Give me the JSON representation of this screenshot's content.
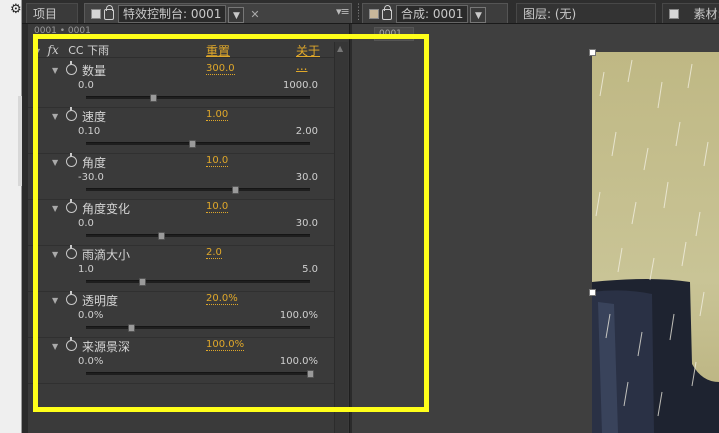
{
  "tabs": {
    "project": "项目",
    "effects_title": "特效控制台: 0001",
    "comp_title": "合成: 0001",
    "layer": "图层: (无)",
    "footage": "素材:"
  },
  "effects": {
    "crumb": "0001 • 0001",
    "effect_name": "CC 下雨",
    "reset": "重置",
    "about": "关于 ...",
    "params": [
      {
        "name": "数量",
        "value": "300.0",
        "min": "0.0",
        "max": "1000.0",
        "fraction": 0.3
      },
      {
        "name": "速度",
        "value": "1.00",
        "min": "0.10",
        "max": "2.00",
        "fraction": 0.474
      },
      {
        "name": "角度",
        "value": "10.0",
        "min": "-30.0",
        "max": "30.0",
        "fraction": 0.667
      },
      {
        "name": "角度变化",
        "value": "10.0",
        "min": "0.0",
        "max": "30.0",
        "fraction": 0.333
      },
      {
        "name": "雨滴大小",
        "value": "2.0",
        "min": "1.0",
        "max": "5.0",
        "fraction": 0.25
      },
      {
        "name": "透明度",
        "value": "20.0%",
        "min": "0.0%",
        "max": "100.0%",
        "fraction": 0.2
      },
      {
        "name": "来源景深",
        "value": "100.0%",
        "min": "0.0%",
        "max": "100.0%",
        "fraction": 1.0
      }
    ]
  },
  "comp": {
    "label": "0001"
  },
  "colors": {
    "accent": "#e0a82a",
    "highlight": "#ffff1a"
  }
}
